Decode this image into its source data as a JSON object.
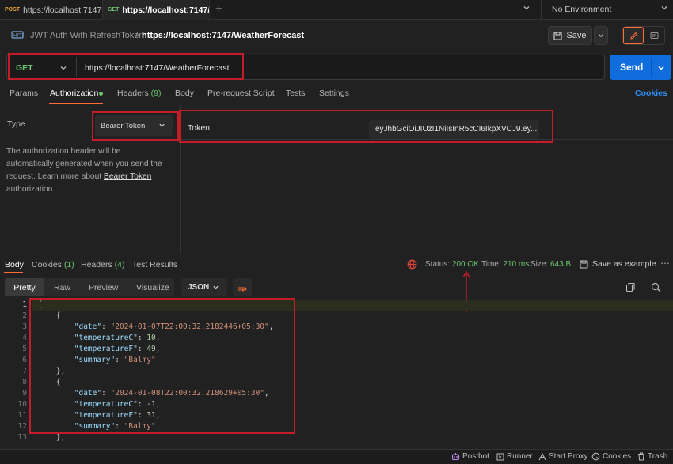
{
  "tabs": [
    {
      "method": "POST",
      "url": "https://localhost:7147",
      "method_color": "#e8a23a"
    },
    {
      "method": "GET",
      "url": "https://localhost:7147/",
      "method_color": "#6cc26c"
    }
  ],
  "new_tab_label": "+",
  "environment": "No Environment",
  "breadcrumb": {
    "collection": "JWT Auth With RefreshToken",
    "separator": "/",
    "request": "https://localhost:7147/WeatherForecast"
  },
  "save_label": "Save",
  "request": {
    "method": "GET",
    "url": "https://localhost:7147/WeatherForecast",
    "send_label": "Send"
  },
  "request_tabs": {
    "params": "Params",
    "authorization": "Authorization",
    "headers": "Headers",
    "headers_count": "(9)",
    "body": "Body",
    "pre_request": "Pre-request Script",
    "tests": "Tests",
    "settings": "Settings",
    "cookies": "Cookies"
  },
  "auth": {
    "type_label": "Type",
    "type_value": "Bearer Token",
    "description_before": "The authorization header will be automatically generated when you send the request. Learn more about ",
    "description_link": "Bearer Token",
    "description_after": " authorization",
    "token_label": "Token",
    "token_value": "eyJhbGciOiJIUzI1NiIsInR5cCI6IkpXVCJ9.ey..."
  },
  "response_tabs": {
    "body": "Body",
    "cookies": "Cookies",
    "cookies_count": "(1)",
    "headers": "Headers",
    "headers_count": "(4)",
    "test_results": "Test Results"
  },
  "response_meta": {
    "status_label": "Status:",
    "status_value": "200 OK",
    "time_label": "Time:",
    "time_value": "210 ms",
    "size_label": "Size:",
    "size_value": "643 B",
    "save_as_example": "Save as example"
  },
  "view_modes": {
    "pretty": "Pretty",
    "raw": "Raw",
    "preview": "Preview",
    "visualize": "Visualize",
    "format": "JSON"
  },
  "code_lines": [
    {
      "n": "1",
      "t": "["
    },
    {
      "n": "2",
      "t": "    {"
    },
    {
      "n": "3",
      "k": "\"date\"",
      "v": "\"2024-01-07T22:00:32.2182446+05:30\"",
      "vt": "str"
    },
    {
      "n": "4",
      "k": "\"temperatureC\"",
      "v": "10",
      "vt": "num"
    },
    {
      "n": "5",
      "k": "\"temperatureF\"",
      "v": "49",
      "vt": "num"
    },
    {
      "n": "6",
      "k": "\"summary\"",
      "v": "\"Balmy\"",
      "vt": "str",
      "last": true
    },
    {
      "n": "7",
      "t": "    },"
    },
    {
      "n": "8",
      "t": "    {"
    },
    {
      "n": "9",
      "k": "\"date\"",
      "v": "\"2024-01-08T22:00:32.218629+05:30\"",
      "vt": "str"
    },
    {
      "n": "10",
      "k": "\"temperatureC\"",
      "v": "-1",
      "vt": "num"
    },
    {
      "n": "11",
      "k": "\"temperatureF\"",
      "v": "31",
      "vt": "num"
    },
    {
      "n": "12",
      "k": "\"summary\"",
      "v": "\"Balmy\"",
      "vt": "str",
      "last": true
    },
    {
      "n": "13",
      "t": "    },"
    }
  ],
  "statusbar": {
    "postbot": "Postbot",
    "runner": "Runner",
    "start_proxy": "Start Proxy",
    "cookies": "Cookies",
    "trash": "Trash"
  },
  "colors": {
    "accent": "#ff6c37",
    "send": "#0f6dde",
    "status_ok": "#6cc26c",
    "highlight_box": "#c21d28",
    "link": "#2f8ff5"
  }
}
